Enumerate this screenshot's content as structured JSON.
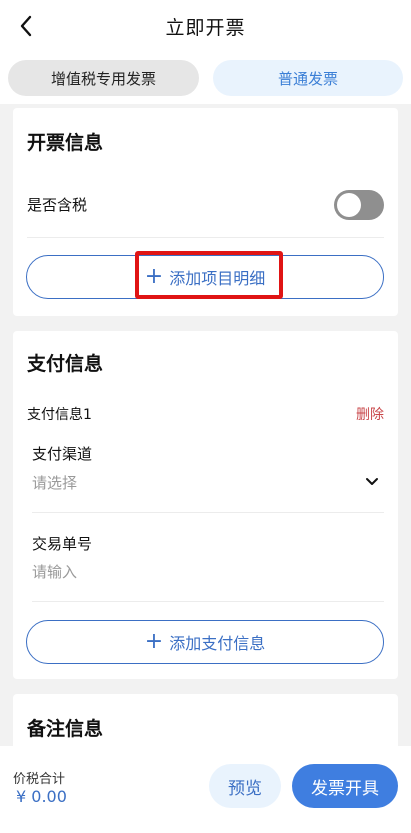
{
  "header": {
    "title": "立即开票"
  },
  "tabs": [
    {
      "label": "增值税专用发票",
      "active": false
    },
    {
      "label": "普通发票",
      "active": true
    }
  ],
  "invoice_info": {
    "title": "开票信息",
    "tax_included_label": "是否含税",
    "tax_included": false,
    "add_item_label": "添加项目明细"
  },
  "payment_info": {
    "title": "支付信息",
    "entry_title": "支付信息1",
    "delete_label": "删除",
    "channel_label": "支付渠道",
    "channel_placeholder": "请选择",
    "transaction_label": "交易单号",
    "transaction_placeholder": "请输入",
    "add_payment_label": "添加支付信息"
  },
  "remark_info": {
    "title": "备注信息"
  },
  "footer": {
    "total_label": "价税合计",
    "total_value": "¥ 0.00",
    "preview_label": "预览",
    "issue_label": "发票开具"
  },
  "colors": {
    "accent": "#3b6fc4",
    "primary_button": "#3f7ee0",
    "delete": "#c9474a",
    "highlight": "#e01414"
  }
}
